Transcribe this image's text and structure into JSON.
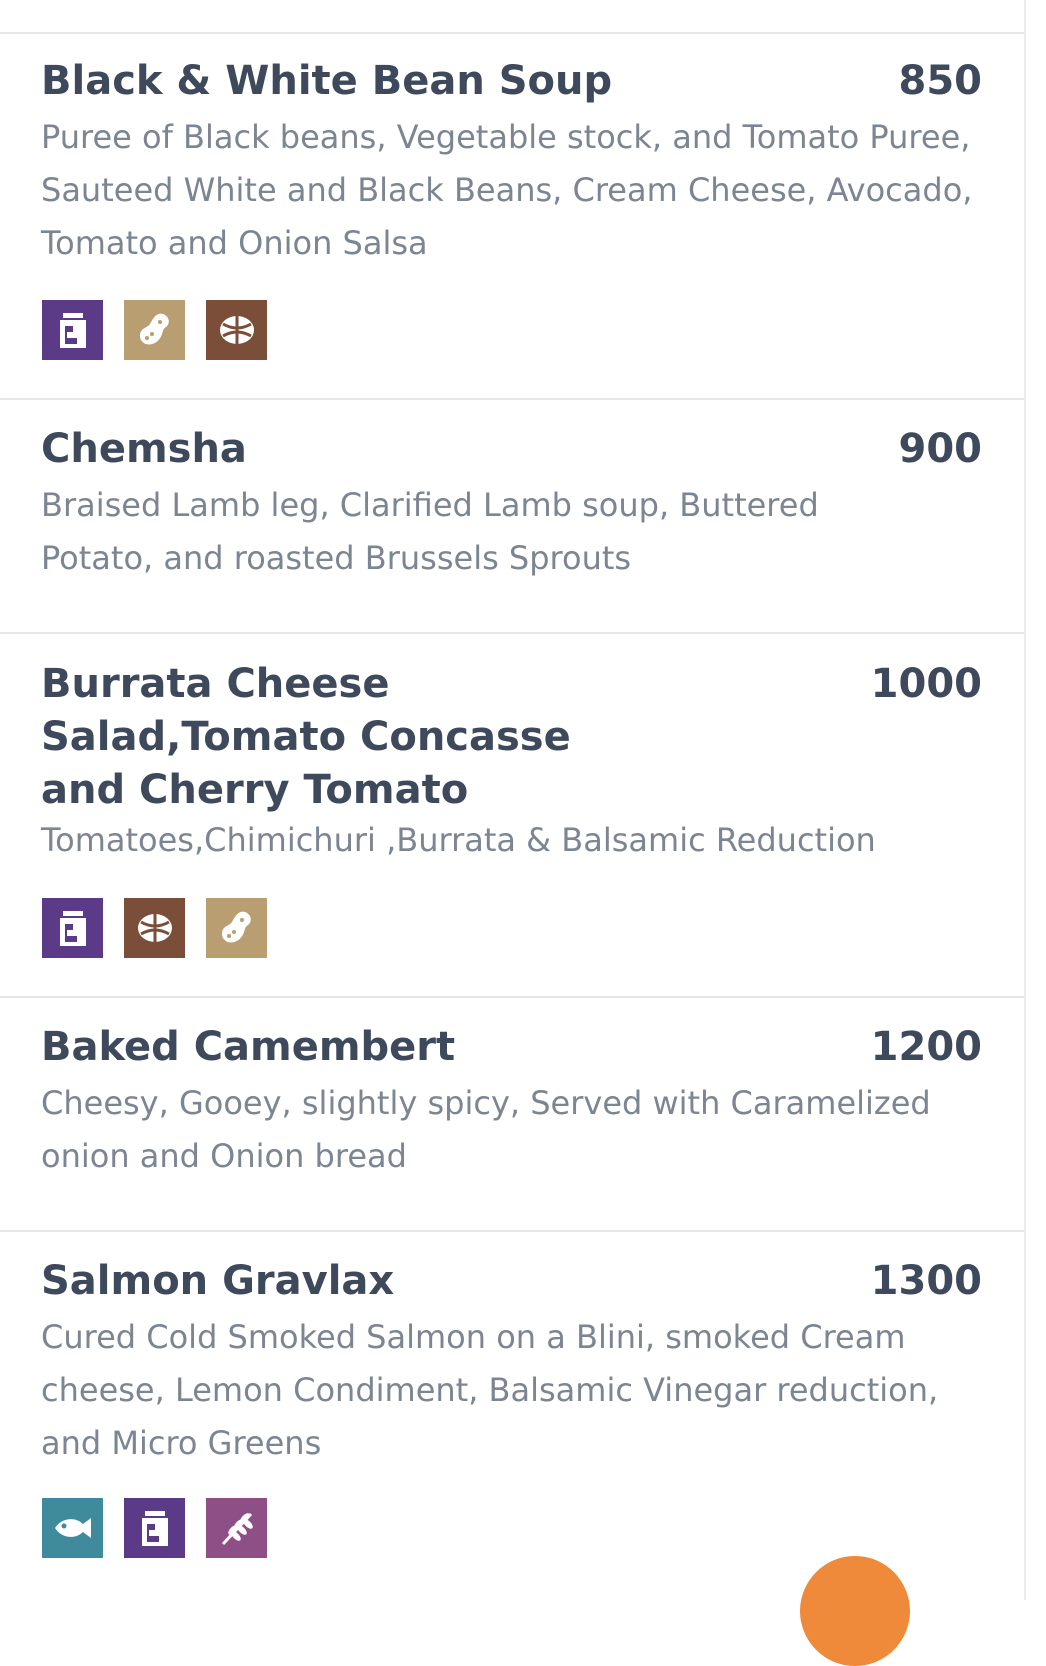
{
  "items": [
    {
      "name": "Black & White Bean Soup",
      "price": "850",
      "description": "Puree of Black beans, Vegetable stock, and Tomato Puree, Sauteed White and Black Beans, Cream Cheese, Avocado, Tomato and Onion Salsa",
      "allergens": [
        {
          "icon": "milk-jar-icon",
          "color": "#5b3a87"
        },
        {
          "icon": "peanut-icon",
          "color": "#b89e70"
        },
        {
          "icon": "walnut-icon",
          "color": "#7a4e38"
        }
      ]
    },
    {
      "name": "Chemsha",
      "price": "900",
      "description": "Braised Lamb leg, Clarified Lamb soup, Buttered Potato, and roasted Brussels Sprouts",
      "allergens": []
    },
    {
      "name": "Burrata Cheese\nSalad,Tomato Concasse\nand Cherry Tomato",
      "price": "1000",
      "description": "Tomatoes,Chimichuri ,Burrata & Balsamic Reduction",
      "allergens": [
        {
          "icon": "milk-jar-icon",
          "color": "#5b3a87"
        },
        {
          "icon": "walnut-icon",
          "color": "#7a4e38"
        },
        {
          "icon": "peanut-icon",
          "color": "#b89e70"
        }
      ]
    },
    {
      "name": "Baked Camembert",
      "price": "1200",
      "description": "Cheesy, Gooey, slightly spicy, Served with Caramelized onion and Onion bread",
      "allergens": []
    },
    {
      "name": "Salmon Gravlax",
      "price": "1300",
      "description": "Cured Cold Smoked Salmon on a Blini, smoked Cream cheese, Lemon Condiment, Balsamic Vinegar reduction, and Micro Greens",
      "allergens": [
        {
          "icon": "fish-icon",
          "color": "#3f8a9c"
        },
        {
          "icon": "milk-jar-icon",
          "color": "#5b3a87"
        },
        {
          "icon": "wheat-icon",
          "color": "#8e4f86"
        }
      ]
    }
  ],
  "accent_color": "#ee8a3a"
}
